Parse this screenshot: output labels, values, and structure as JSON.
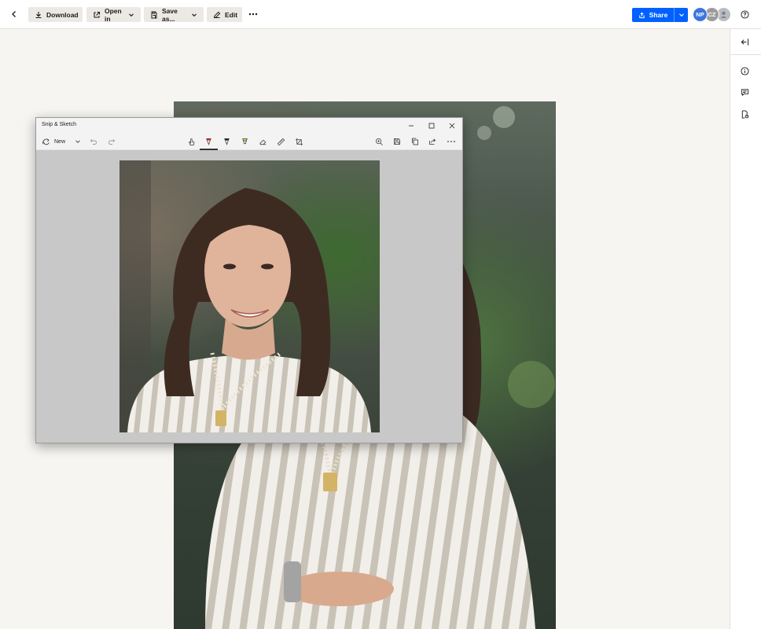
{
  "toolbar": {
    "back_icon": "chevron-left-icon",
    "download_label": "Download",
    "open_in_label": "Open in",
    "save_as_label": "Save as...",
    "edit_label": "Edit",
    "more_icon": "ellipsis-icon",
    "share_label": "Share",
    "share_color": "#0061fe",
    "avatars": [
      {
        "initials": "NP",
        "color": "#3d74e0"
      },
      {
        "initials": "CZ",
        "color": "#9c9c9c"
      },
      {
        "initials": "",
        "color": "#b9bcc0"
      }
    ],
    "help_icon": "help-icon"
  },
  "right_rail": {
    "icons": [
      "collapse-panel-icon",
      "info-icon",
      "comment-icon",
      "file-activity-icon"
    ]
  },
  "snip_window": {
    "title": "Snip & Sketch",
    "new_label": "New",
    "tools": [
      "touch-writing-icon",
      "ballpoint-pen-icon",
      "pencil-icon",
      "highlighter-icon",
      "eraser-icon",
      "ruler-icon",
      "crop-icon"
    ],
    "actions": [
      "zoom-icon",
      "save-icon",
      "copy-icon",
      "share-icon",
      "more-icon"
    ]
  }
}
